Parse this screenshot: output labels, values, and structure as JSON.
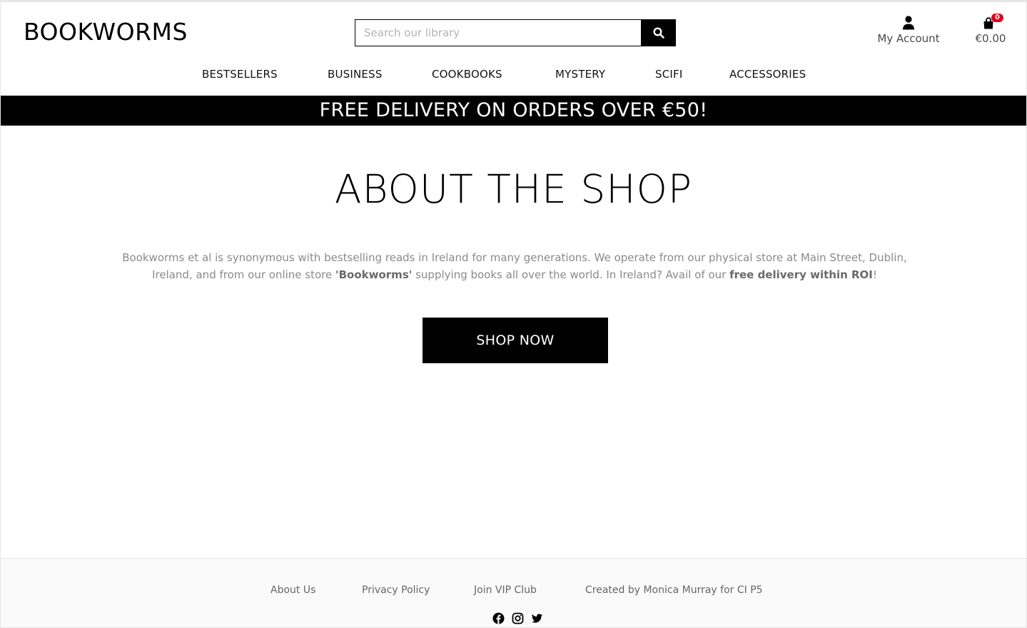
{
  "header": {
    "logo": "BOOKWORMS",
    "search": {
      "placeholder": "Search our library",
      "value": ""
    },
    "account_label": "My Account",
    "bag": {
      "count": "0",
      "total": "€0.00"
    }
  },
  "nav": {
    "items": [
      "BESTSELLERS",
      "BUSINESS",
      "COOKBOOKS",
      "MYSTERY",
      "SCIFI",
      "ACCESSORIES"
    ]
  },
  "banner": {
    "text": "FREE DELIVERY ON ORDERS OVER €50!"
  },
  "main": {
    "title": "ABOUT THE SHOP",
    "text_part1": "Bookworms et al is synonymous with bestselling reads in Ireland for many generations. We operate from our physical store at Main Street, Dublin, Ireland, and from our online store ",
    "text_bold1": "'Bookworms'",
    "text_part2": " supplying books all over the world. In Ireland? Avail of our ",
    "text_bold2": "free delivery within ROI",
    "text_part3": "!",
    "button_label": "SHOP NOW"
  },
  "footer": {
    "links": [
      "About Us",
      "Privacy Policy",
      "Join VIP Club"
    ],
    "credit": "Created by Monica Murray for CI P5",
    "social": [
      "facebook-icon",
      "instagram-icon",
      "twitter-icon"
    ]
  }
}
